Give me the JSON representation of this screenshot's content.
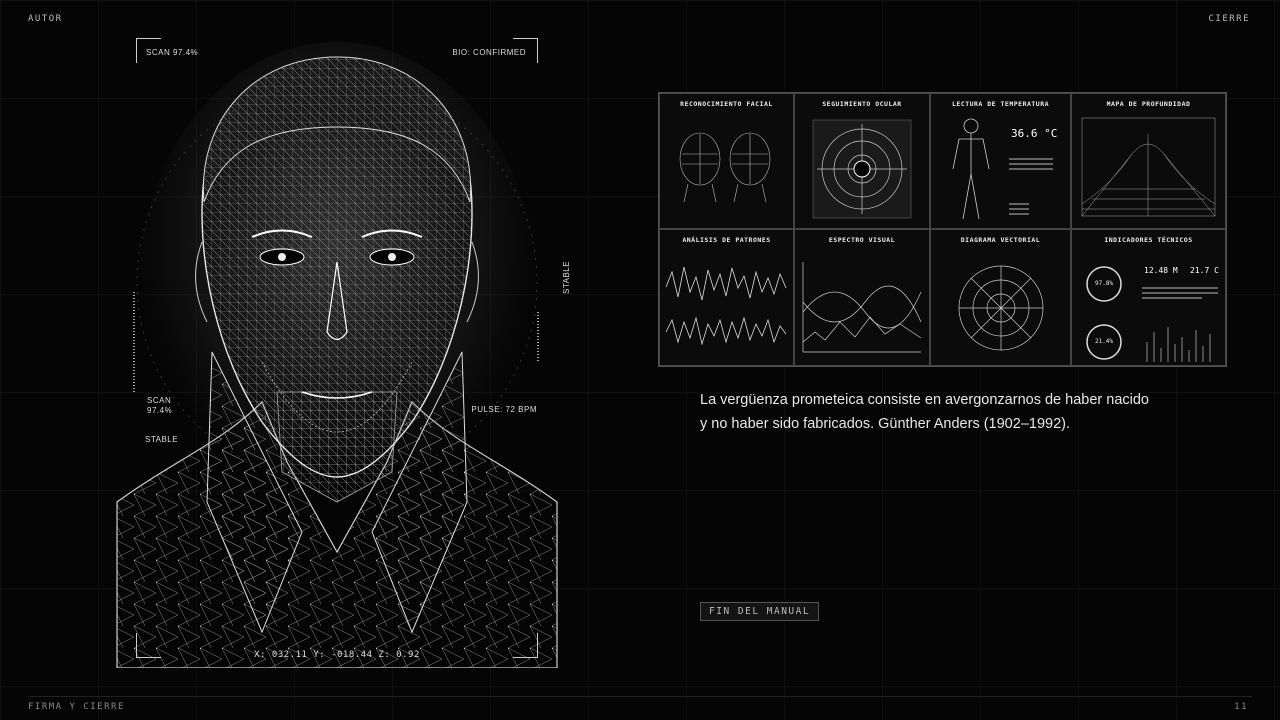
{
  "header": {
    "left_label": "AUTOR",
    "right_label": "CIERRE"
  },
  "footer": {
    "section_label": "FIRMA Y CIERRE",
    "page_number": "11"
  },
  "portrait": {
    "scan_top": "SCAN 97.4%",
    "bio": "BIO: CONFIRMED",
    "scan_side_line1": "SCAN",
    "scan_side_line2": "97.4%",
    "stable_left": "STABLE",
    "stable_right": "STABLE",
    "pulse": "PULSE: 72 BPM",
    "coords": "X: 032.11  Y: -018.44  Z: 0.92"
  },
  "dashboard": {
    "panels": [
      {
        "title": "RECONOCIMIENTO FACIAL"
      },
      {
        "title": "SEGUIMIENTO OCULAR"
      },
      {
        "title": "LECTURA DE TEMPERATURA",
        "value": "36.6 °C"
      },
      {
        "title": "MAPA DE PROFUNDIDAD"
      },
      {
        "title": "ANÁLISIS DE PATRONES"
      },
      {
        "title": "ESPECTRO VISUAL"
      },
      {
        "title": "DIAGRAMA VECTORIAL"
      },
      {
        "title": "INDICADORES TÉCNICOS",
        "value_a": "12.48 M",
        "value_b": "21.7 C",
        "ring_a": "97.8%",
        "ring_b": "21.4%"
      }
    ]
  },
  "quote": {
    "line1": "La vergüenza prometeica consiste en avergonzarnos de haber nacido",
    "line2": "y no haber sido fabricados. Günther Anders (1902–1992)."
  },
  "end_button": "FIN DEL MANUAL"
}
